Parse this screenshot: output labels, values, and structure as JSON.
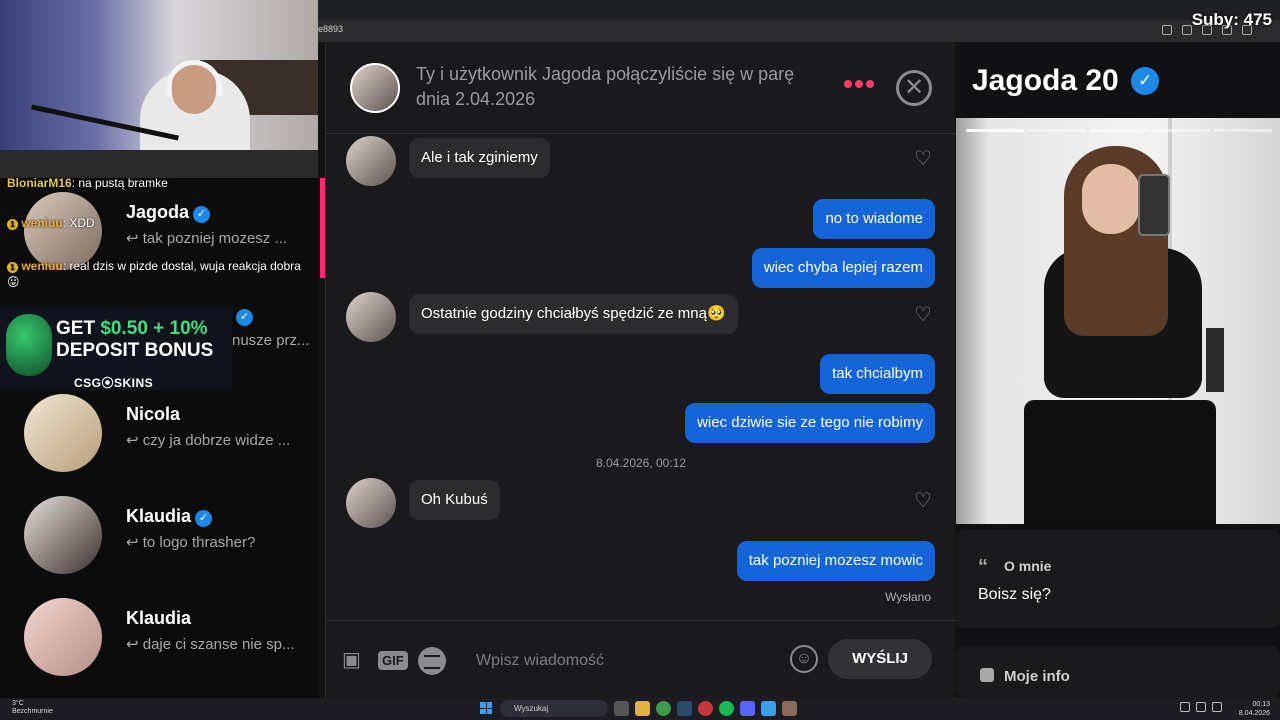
{
  "stream": {
    "subs_label": "Suby: 475",
    "address_text": "e8893",
    "chat": [
      {
        "user": "BloniarM16",
        "text": "na pustą bramke",
        "badge": ""
      },
      {
        "user": "weniuu",
        "text": "XDD",
        "badge": "1"
      },
      {
        "user": "weniuu",
        "text": "real dzis w pizde dostal, wuja reakcja dobra 😛",
        "badge": "1"
      }
    ],
    "ad": {
      "line1_prefix": "GET",
      "line1_amount": "$0.50 + 10%",
      "line2": "DEPOSIT BONUS",
      "brand": "CSG⦿SKINS"
    }
  },
  "conversations": [
    {
      "name": "Jagoda",
      "verified": true,
      "snippet": "↩ tak pozniej mozesz ..."
    },
    {
      "name": "",
      "verified": true,
      "snippet": "nusze prz..."
    },
    {
      "name": "Nicola",
      "verified": false,
      "snippet": "↩ czy ja dobrze widze ..."
    },
    {
      "name": "Klaudia",
      "verified": true,
      "snippet": "↩ to logo thrasher?"
    },
    {
      "name": "Klaudia",
      "verified": false,
      "snippet": "↩ daje ci szanse nie sp..."
    }
  ],
  "chat_header": {
    "info": "Ty i użytkownik Jagoda połączyliście się w parę dnia 2.04.2026"
  },
  "messages": [
    {
      "dir": "in",
      "text": "Ale i tak zginiemy"
    },
    {
      "dir": "out",
      "text": "no to wiadome"
    },
    {
      "dir": "out",
      "text": "wiec chyba lepiej razem"
    },
    {
      "dir": "in",
      "text": "Ostatnie godziny chciałbyś spędzić ze mną🥺"
    },
    {
      "dir": "out",
      "text": "tak chcialbym"
    },
    {
      "dir": "out",
      "text": "wiec dziwie sie ze tego nie robimy"
    },
    {
      "dir": "in",
      "text": "Oh Kubuś"
    },
    {
      "dir": "out",
      "text": "tak pozniej mozesz mowic"
    }
  ],
  "date_separator": "8.04.2026, 00:12",
  "sent_status": "Wysłano",
  "composer": {
    "placeholder": "Wpisz wiadomość",
    "gif_label": "GIF",
    "send_label": "WYŚLIJ"
  },
  "profile": {
    "name": "Jagoda 20",
    "about_label": "O mnie",
    "about_text": "Boisz się?",
    "more_info_label": "Moje info",
    "photo_count": 5,
    "active_photo": 1
  },
  "taskbar": {
    "weather_temp": "3°C",
    "weather_desc": "Bezchmurnie",
    "search_placeholder": "Wyszukaj",
    "time": "00:13",
    "date": "8.04.2026"
  },
  "colors": {
    "accent_pink": "#ff3b6b",
    "outgoing_bubble": "#1565d8",
    "verified_blue": "#1e88e5"
  }
}
